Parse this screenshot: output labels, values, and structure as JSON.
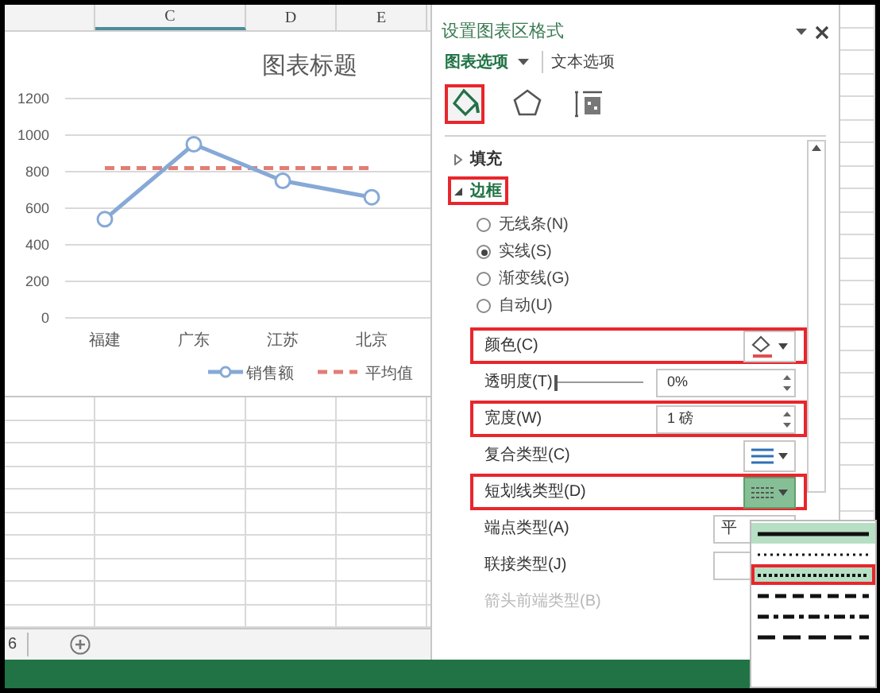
{
  "sheet": {
    "columns": [
      {
        "label": "C",
        "selected": true
      },
      {
        "label": "D",
        "selected": false
      },
      {
        "label": "E",
        "selected": false
      }
    ],
    "tab_fragment": "6"
  },
  "chart": {
    "chart_data": {
      "type": "line",
      "title": "图表标题",
      "categories": [
        "福建",
        "广东",
        "江苏",
        "北京"
      ],
      "ylim": [
        0,
        1200
      ],
      "yticks": [
        0,
        200,
        400,
        600,
        800,
        1000,
        1200
      ],
      "grid": true,
      "legend": true,
      "series": [
        {
          "name": "销售额",
          "color": "#86a9d6",
          "marker": "circle",
          "line_style": "solid",
          "values": [
            540,
            950,
            750,
            660
          ]
        },
        {
          "name": "平均值",
          "color": "#e27d76",
          "marker": "none",
          "line_style": "dashed",
          "values": [
            820,
            820,
            820,
            820
          ]
        }
      ]
    }
  },
  "panel": {
    "title": "设置图表区格式",
    "tabs": [
      {
        "label": "图表选项",
        "selected": true
      },
      {
        "label": "文本选项",
        "selected": false
      }
    ],
    "icon_tabs": [
      {
        "kind": "fill",
        "selected": true,
        "highlighted": true
      },
      {
        "kind": "effects",
        "selected": false,
        "highlighted": false
      },
      {
        "kind": "size",
        "selected": false,
        "highlighted": false
      }
    ],
    "sections": [
      {
        "label": "填充",
        "expanded": false,
        "highlighted": false
      },
      {
        "label": "边框",
        "expanded": true,
        "highlighted": true
      }
    ],
    "line_options": [
      {
        "label": "无线条(N)",
        "selected": false
      },
      {
        "label": "实线(S)",
        "selected": true
      },
      {
        "label": "渐变线(G)",
        "selected": false
      },
      {
        "label": "自动(U)",
        "selected": false
      }
    ],
    "properties": [
      {
        "kind": "color",
        "label": "颜色(C)",
        "highlighted": true
      },
      {
        "kind": "slider",
        "label": "透明度(T)",
        "level": 0,
        "value": "0%",
        "highlighted": false
      },
      {
        "kind": "spinner",
        "label": "宽度(W)",
        "value": "1 磅",
        "highlighted": true
      },
      {
        "kind": "compound",
        "label": "复合类型(C)",
        "highlighted": false
      },
      {
        "kind": "dash",
        "label": "短划线类型(D)",
        "highlighted": true,
        "open": true
      },
      {
        "kind": "select",
        "label": "端点类型(A)",
        "value": "平",
        "highlighted": false
      },
      {
        "kind": "select",
        "label": "联接类型(J)",
        "highlighted": false
      },
      {
        "kind": "plain",
        "label": "箭头前端类型(B)",
        "disabled": true,
        "highlighted": false
      }
    ],
    "dash_menu": [
      {
        "kind": "solid",
        "hovered": true,
        "selected": false
      },
      {
        "kind": "rounddot",
        "hovered": false,
        "selected": false
      },
      {
        "kind": "squaredot",
        "hovered": false,
        "selected": true
      },
      {
        "kind": "dash",
        "hovered": false,
        "selected": false
      },
      {
        "kind": "dashdot",
        "hovered": false,
        "selected": false
      },
      {
        "kind": "longdash",
        "hovered": false,
        "selected": false
      }
    ]
  }
}
